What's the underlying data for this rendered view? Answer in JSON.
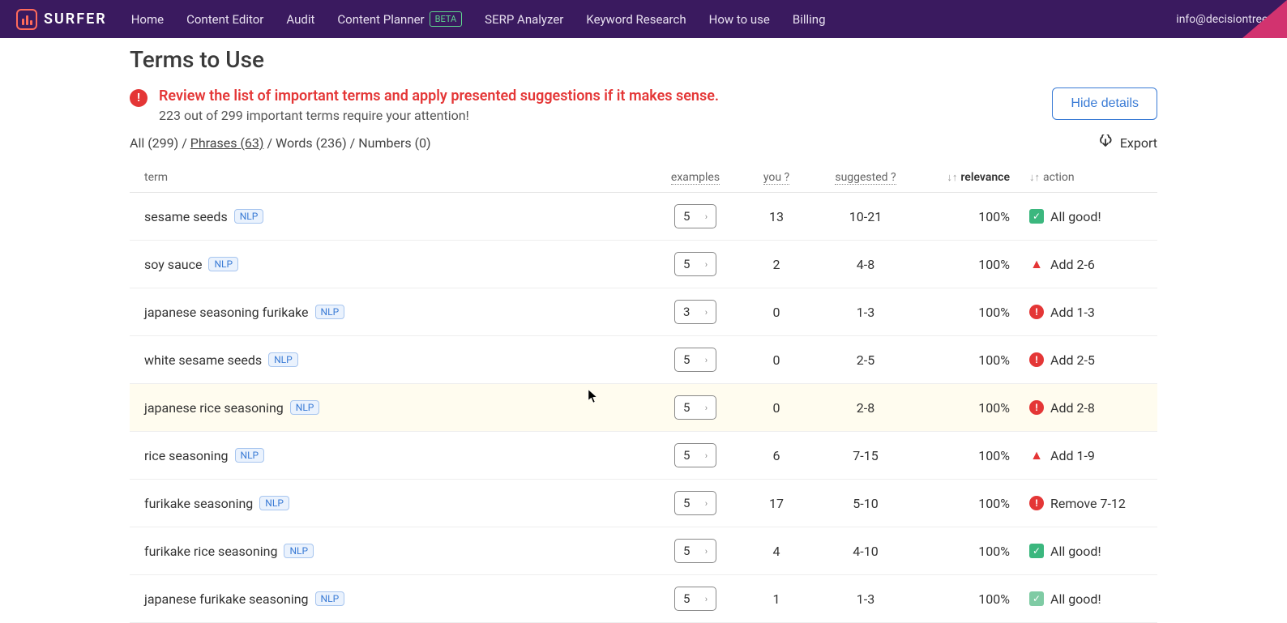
{
  "brand": "SURFER",
  "nav": {
    "items": [
      {
        "label": "Home"
      },
      {
        "label": "Content Editor"
      },
      {
        "label": "Audit"
      },
      {
        "label": "Content Planner",
        "badge": "BETA"
      },
      {
        "label": "SERP Analyzer"
      },
      {
        "label": "Keyword Research"
      },
      {
        "label": "How to use"
      },
      {
        "label": "Billing"
      }
    ],
    "email": "info@decisiontree."
  },
  "page_title": "Terms to Use",
  "alert": {
    "title": "Review the list of important terms and apply presented suggestions if it makes sense.",
    "subtitle": "223 out of 299 important terms require your attention!"
  },
  "hide_details": "Hide details",
  "filters": {
    "all": "All (299)",
    "sep1": " / ",
    "phrases": "Phrases (63)",
    "sep2": " / ",
    "words": "Words (236)",
    "sep3": " / ",
    "numbers": "Numbers (0)"
  },
  "export_label": "Export",
  "columns": {
    "term": "term",
    "examples": "examples",
    "you": "you ?",
    "suggested": "suggested ?",
    "relevance": "relevance",
    "action": "action"
  },
  "rows": [
    {
      "term": "sesame seeds",
      "nlp": "NLP",
      "examples": "5",
      "you": "13",
      "suggested": "10-21",
      "relevance": "100%",
      "action_type": "check",
      "action_text": "All good!",
      "highlight": false
    },
    {
      "term": "soy sauce",
      "nlp": "NLP",
      "examples": "5",
      "you": "2",
      "suggested": "4-8",
      "relevance": "100%",
      "action_type": "warn-tri",
      "action_text": "Add 2-6",
      "highlight": false
    },
    {
      "term": "japanese seasoning furikake",
      "nlp": "NLP",
      "examples": "3",
      "you": "0",
      "suggested": "1-3",
      "relevance": "100%",
      "action_type": "warn-circ",
      "action_text": "Add 1-3",
      "highlight": false
    },
    {
      "term": "white sesame seeds",
      "nlp": "NLP",
      "examples": "5",
      "you": "0",
      "suggested": "2-5",
      "relevance": "100%",
      "action_type": "warn-circ",
      "action_text": "Add 2-5",
      "highlight": false
    },
    {
      "term": "japanese rice seasoning",
      "nlp": "NLP",
      "examples": "5",
      "you": "0",
      "suggested": "2-8",
      "relevance": "100%",
      "action_type": "warn-circ",
      "action_text": "Add 2-8",
      "highlight": true
    },
    {
      "term": "rice seasoning",
      "nlp": "NLP",
      "examples": "5",
      "you": "6",
      "suggested": "7-15",
      "relevance": "100%",
      "action_type": "warn-tri",
      "action_text": "Add 1-9",
      "highlight": false
    },
    {
      "term": "furikake seasoning",
      "nlp": "NLP",
      "examples": "5",
      "you": "17",
      "suggested": "5-10",
      "relevance": "100%",
      "action_type": "warn-circ",
      "action_text": "Remove 7-12",
      "highlight": false
    },
    {
      "term": "furikake rice seasoning",
      "nlp": "NLP",
      "examples": "5",
      "you": "4",
      "suggested": "4-10",
      "relevance": "100%",
      "action_type": "check",
      "action_text": "All good!",
      "highlight": false
    },
    {
      "term": "japanese furikake seasoning",
      "nlp": "NLP",
      "examples": "5",
      "you": "1",
      "suggested": "1-3",
      "relevance": "100%",
      "action_type": "check-light",
      "action_text": "All good!",
      "highlight": false
    }
  ]
}
